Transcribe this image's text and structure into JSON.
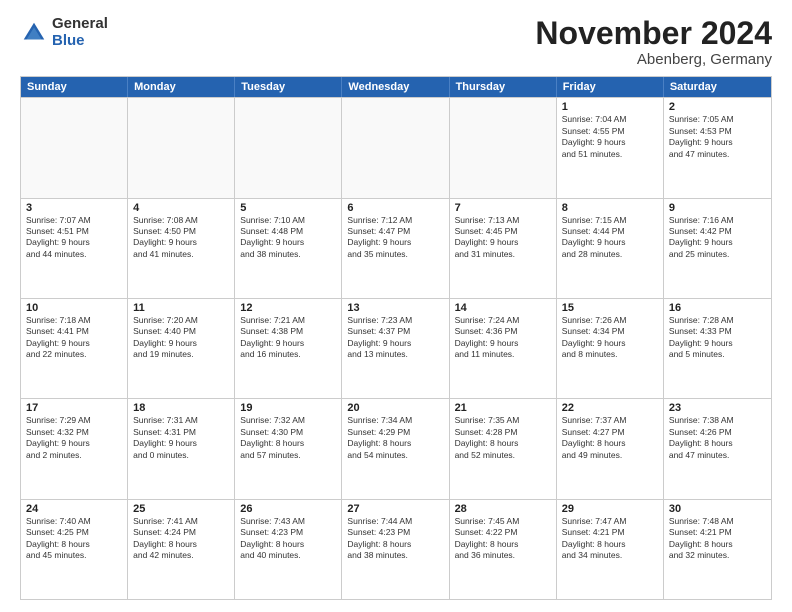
{
  "logo": {
    "general": "General",
    "blue": "Blue"
  },
  "title": "November 2024",
  "subtitle": "Abenberg, Germany",
  "days": [
    "Sunday",
    "Monday",
    "Tuesday",
    "Wednesday",
    "Thursday",
    "Friday",
    "Saturday"
  ],
  "rows": [
    [
      {
        "day": "",
        "text": "",
        "empty": true
      },
      {
        "day": "",
        "text": "",
        "empty": true
      },
      {
        "day": "",
        "text": "",
        "empty": true
      },
      {
        "day": "",
        "text": "",
        "empty": true
      },
      {
        "day": "",
        "text": "",
        "empty": true
      },
      {
        "day": "1",
        "text": "Sunrise: 7:04 AM\nSunset: 4:55 PM\nDaylight: 9 hours\nand 51 minutes.",
        "empty": false
      },
      {
        "day": "2",
        "text": "Sunrise: 7:05 AM\nSunset: 4:53 PM\nDaylight: 9 hours\nand 47 minutes.",
        "empty": false
      }
    ],
    [
      {
        "day": "3",
        "text": "Sunrise: 7:07 AM\nSunset: 4:51 PM\nDaylight: 9 hours\nand 44 minutes.",
        "empty": false
      },
      {
        "day": "4",
        "text": "Sunrise: 7:08 AM\nSunset: 4:50 PM\nDaylight: 9 hours\nand 41 minutes.",
        "empty": false
      },
      {
        "day": "5",
        "text": "Sunrise: 7:10 AM\nSunset: 4:48 PM\nDaylight: 9 hours\nand 38 minutes.",
        "empty": false
      },
      {
        "day": "6",
        "text": "Sunrise: 7:12 AM\nSunset: 4:47 PM\nDaylight: 9 hours\nand 35 minutes.",
        "empty": false
      },
      {
        "day": "7",
        "text": "Sunrise: 7:13 AM\nSunset: 4:45 PM\nDaylight: 9 hours\nand 31 minutes.",
        "empty": false
      },
      {
        "day": "8",
        "text": "Sunrise: 7:15 AM\nSunset: 4:44 PM\nDaylight: 9 hours\nand 28 minutes.",
        "empty": false
      },
      {
        "day": "9",
        "text": "Sunrise: 7:16 AM\nSunset: 4:42 PM\nDaylight: 9 hours\nand 25 minutes.",
        "empty": false
      }
    ],
    [
      {
        "day": "10",
        "text": "Sunrise: 7:18 AM\nSunset: 4:41 PM\nDaylight: 9 hours\nand 22 minutes.",
        "empty": false
      },
      {
        "day": "11",
        "text": "Sunrise: 7:20 AM\nSunset: 4:40 PM\nDaylight: 9 hours\nand 19 minutes.",
        "empty": false
      },
      {
        "day": "12",
        "text": "Sunrise: 7:21 AM\nSunset: 4:38 PM\nDaylight: 9 hours\nand 16 minutes.",
        "empty": false
      },
      {
        "day": "13",
        "text": "Sunrise: 7:23 AM\nSunset: 4:37 PM\nDaylight: 9 hours\nand 13 minutes.",
        "empty": false
      },
      {
        "day": "14",
        "text": "Sunrise: 7:24 AM\nSunset: 4:36 PM\nDaylight: 9 hours\nand 11 minutes.",
        "empty": false
      },
      {
        "day": "15",
        "text": "Sunrise: 7:26 AM\nSunset: 4:34 PM\nDaylight: 9 hours\nand 8 minutes.",
        "empty": false
      },
      {
        "day": "16",
        "text": "Sunrise: 7:28 AM\nSunset: 4:33 PM\nDaylight: 9 hours\nand 5 minutes.",
        "empty": false
      }
    ],
    [
      {
        "day": "17",
        "text": "Sunrise: 7:29 AM\nSunset: 4:32 PM\nDaylight: 9 hours\nand 2 minutes.",
        "empty": false
      },
      {
        "day": "18",
        "text": "Sunrise: 7:31 AM\nSunset: 4:31 PM\nDaylight: 9 hours\nand 0 minutes.",
        "empty": false
      },
      {
        "day": "19",
        "text": "Sunrise: 7:32 AM\nSunset: 4:30 PM\nDaylight: 8 hours\nand 57 minutes.",
        "empty": false
      },
      {
        "day": "20",
        "text": "Sunrise: 7:34 AM\nSunset: 4:29 PM\nDaylight: 8 hours\nand 54 minutes.",
        "empty": false
      },
      {
        "day": "21",
        "text": "Sunrise: 7:35 AM\nSunset: 4:28 PM\nDaylight: 8 hours\nand 52 minutes.",
        "empty": false
      },
      {
        "day": "22",
        "text": "Sunrise: 7:37 AM\nSunset: 4:27 PM\nDaylight: 8 hours\nand 49 minutes.",
        "empty": false
      },
      {
        "day": "23",
        "text": "Sunrise: 7:38 AM\nSunset: 4:26 PM\nDaylight: 8 hours\nand 47 minutes.",
        "empty": false
      }
    ],
    [
      {
        "day": "24",
        "text": "Sunrise: 7:40 AM\nSunset: 4:25 PM\nDaylight: 8 hours\nand 45 minutes.",
        "empty": false
      },
      {
        "day": "25",
        "text": "Sunrise: 7:41 AM\nSunset: 4:24 PM\nDaylight: 8 hours\nand 42 minutes.",
        "empty": false
      },
      {
        "day": "26",
        "text": "Sunrise: 7:43 AM\nSunset: 4:23 PM\nDaylight: 8 hours\nand 40 minutes.",
        "empty": false
      },
      {
        "day": "27",
        "text": "Sunrise: 7:44 AM\nSunset: 4:23 PM\nDaylight: 8 hours\nand 38 minutes.",
        "empty": false
      },
      {
        "day": "28",
        "text": "Sunrise: 7:45 AM\nSunset: 4:22 PM\nDaylight: 8 hours\nand 36 minutes.",
        "empty": false
      },
      {
        "day": "29",
        "text": "Sunrise: 7:47 AM\nSunset: 4:21 PM\nDaylight: 8 hours\nand 34 minutes.",
        "empty": false
      },
      {
        "day": "30",
        "text": "Sunrise: 7:48 AM\nSunset: 4:21 PM\nDaylight: 8 hours\nand 32 minutes.",
        "empty": false
      }
    ]
  ]
}
